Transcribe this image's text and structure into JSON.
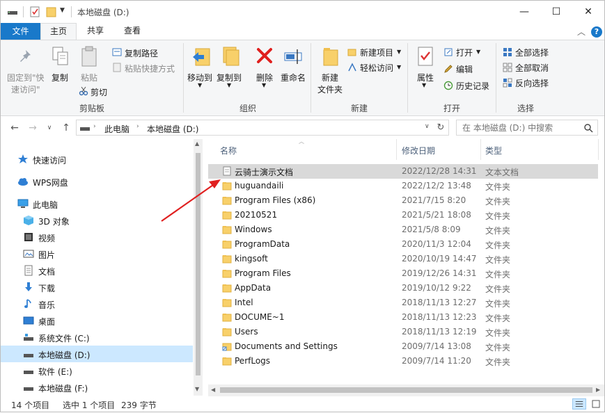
{
  "window": {
    "title": "本地磁盘 (D:)",
    "controls": {
      "minimize": "—",
      "maximize": "☐",
      "close": "✕"
    }
  },
  "ribbon_tabs": {
    "file": "文件",
    "home": "主页",
    "share": "共享",
    "view": "查看"
  },
  "ribbon": {
    "clipboard": {
      "pin_line1": "固定到\"快",
      "pin_line2": "速访问\"",
      "copy": "复制",
      "paste": "粘贴",
      "copy_path": "复制路径",
      "paste_shortcut": "粘贴快捷方式",
      "cut": "剪切",
      "group": "剪贴板"
    },
    "organize": {
      "move_to": "移动到",
      "copy_to": "复制到",
      "delete": "删除",
      "rename": "重命名",
      "group": "组织"
    },
    "new": {
      "new_folder_line1": "新建",
      "new_folder_line2": "文件夹",
      "new_item": "新建项目",
      "easy_access": "轻松访问",
      "group": "新建"
    },
    "open": {
      "properties": "属性",
      "open": "打开",
      "edit": "编辑",
      "history": "历史记录",
      "group": "打开"
    },
    "select": {
      "select_all": "全部选择",
      "select_none": "全部取消",
      "invert": "反向选择",
      "group": "选择"
    }
  },
  "address": {
    "crumb1": "此电脑",
    "crumb2": "本地磁盘 (D:)",
    "search_placeholder": "在 本地磁盘 (D:) 中搜索"
  },
  "nav_pane": {
    "quick_access": "快速访问",
    "wps": "WPS网盘",
    "this_pc": "此电脑",
    "objects3d": "3D 对象",
    "videos": "视频",
    "pictures": "图片",
    "documents": "文档",
    "downloads": "下载",
    "music": "音乐",
    "desktop": "桌面",
    "drive_c": "系统文件 (C:)",
    "drive_d": "本地磁盘 (D:)",
    "drive_e": "软件 (E:)",
    "drive_f": "本地磁盘 (F:)"
  },
  "columns": {
    "name": "名称",
    "date": "修改日期",
    "type": "类型"
  },
  "files": [
    {
      "name": "云骑士演示文档",
      "date": "2022/12/28 14:31",
      "type": "文本文档",
      "icon": "text-file"
    },
    {
      "name": "huguandaili",
      "date": "2022/12/2 13:48",
      "type": "文件夹",
      "icon": "folder"
    },
    {
      "name": "Program Files (x86)",
      "date": "2021/7/15 8:20",
      "type": "文件夹",
      "icon": "folder"
    },
    {
      "name": "20210521",
      "date": "2021/5/21 18:08",
      "type": "文件夹",
      "icon": "folder"
    },
    {
      "name": "Windows",
      "date": "2021/5/8 8:09",
      "type": "文件夹",
      "icon": "folder"
    },
    {
      "name": "ProgramData",
      "date": "2020/11/3 12:04",
      "type": "文件夹",
      "icon": "folder"
    },
    {
      "name": "kingsoft",
      "date": "2020/10/19 14:47",
      "type": "文件夹",
      "icon": "folder"
    },
    {
      "name": "Program Files",
      "date": "2019/12/26 14:31",
      "type": "文件夹",
      "icon": "folder"
    },
    {
      "name": "AppData",
      "date": "2019/10/12 9:22",
      "type": "文件夹",
      "icon": "folder"
    },
    {
      "name": "Intel",
      "date": "2018/11/13 12:27",
      "type": "文件夹",
      "icon": "folder"
    },
    {
      "name": "DOCUME~1",
      "date": "2018/11/13 12:23",
      "type": "文件夹",
      "icon": "folder"
    },
    {
      "name": "Users",
      "date": "2018/11/13 12:19",
      "type": "文件夹",
      "icon": "folder"
    },
    {
      "name": "Documents and Settings",
      "date": "2009/7/14 13:08",
      "type": "文件夹",
      "icon": "folder-shortcut"
    },
    {
      "name": "PerfLogs",
      "date": "2009/7/14 11:20",
      "type": "文件夹",
      "icon": "folder"
    }
  ],
  "status": {
    "count": "14 个项目",
    "selected": "选中 1 个项目",
    "size": "239 字节"
  },
  "colors": {
    "accent": "#1979ca",
    "selection": "#cce8ff",
    "row_selected": "#d9d9d9",
    "folder": "#f8d06a",
    "arrow": "#e02020"
  }
}
